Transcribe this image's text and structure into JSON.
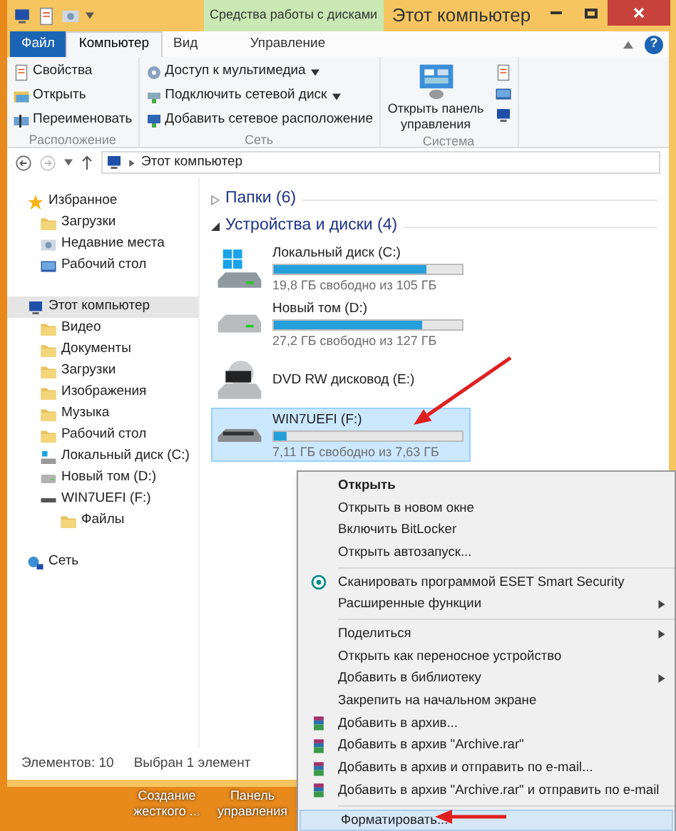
{
  "window": {
    "title": "Этот компьютер",
    "context_tab": "Средства работы с дисками"
  },
  "ribbon_tabs": [
    {
      "label": "Файл",
      "kind": "file",
      "selected": false
    },
    {
      "label": "Компьютер",
      "kind": "tab",
      "selected": true
    },
    {
      "label": "Вид",
      "kind": "tab",
      "selected": false
    },
    {
      "label": "Управление",
      "kind": "context",
      "selected": false
    }
  ],
  "help_button": "?",
  "ribbon_groups": [
    {
      "title": "Расположение",
      "kind": "list",
      "items": [
        {
          "label": "Свойства",
          "dropdown": false
        },
        {
          "label": "Открыть",
          "dropdown": false
        },
        {
          "label": "Переименовать",
          "dropdown": false
        }
      ]
    },
    {
      "title": "Сеть",
      "kind": "list",
      "items": [
        {
          "label": "Доступ к мультимедиа",
          "dropdown": true
        },
        {
          "label": "Подключить сетевой диск",
          "dropdown": true
        },
        {
          "label": "Добавить сетевое расположение",
          "dropdown": false
        }
      ]
    },
    {
      "title": "Система",
      "kind": "big",
      "items": [
        {
          "label": "Открыть панель управления"
        }
      ]
    }
  ],
  "address": {
    "path": "Этот компьютер"
  },
  "nav": [
    {
      "label": "Избранное",
      "selected": false,
      "children": [
        {
          "label": "Загрузки",
          "selected": false
        },
        {
          "label": "Недавние места",
          "selected": false
        },
        {
          "label": "Рабочий стол",
          "selected": false
        }
      ]
    },
    {
      "label": "Этот компьютер",
      "selected": true,
      "children": [
        {
          "label": "Видео",
          "selected": false
        },
        {
          "label": "Документы",
          "selected": false
        },
        {
          "label": "Загрузки",
          "selected": false
        },
        {
          "label": "Изображения",
          "selected": false
        },
        {
          "label": "Музыка",
          "selected": false
        },
        {
          "label": "Рабочий стол",
          "selected": false
        },
        {
          "label": "Локальный диск (C:)",
          "selected": false
        },
        {
          "label": "Новый том (D:)",
          "selected": false
        },
        {
          "label": "WIN7UEFI (F:)",
          "selected": false,
          "children": [
            {
              "label": "Файлы",
              "selected": false
            }
          ]
        }
      ]
    },
    {
      "label": "Сеть",
      "selected": false
    }
  ],
  "sections": [
    {
      "title": "Папки (6)",
      "expanded": false
    },
    {
      "title": "Устройства и диски (4)",
      "expanded": true
    }
  ],
  "drives": [
    {
      "name": "Локальный диск (C:)",
      "kind": "system",
      "level": 0.81,
      "free": "19,8 ГБ свободно из 105 ГБ",
      "selected": false
    },
    {
      "name": "Новый том (D:)",
      "kind": "disk",
      "level": 0.79,
      "free": "27,2 ГБ свободно из 127 ГБ",
      "selected": false
    },
    {
      "name": "DVD RW дисковод (E:)",
      "kind": "dvd",
      "selected": false
    },
    {
      "name": "WIN7UEFI (F:)",
      "kind": "usb",
      "level": 0.07,
      "free": "7,11 ГБ свободно из 7,63 ГБ",
      "selected": true
    }
  ],
  "status_bar": {
    "count": "Элементов: 10",
    "selection": "Выбран 1 элемент"
  },
  "desktop_icons": [
    {
      "label": "Создание жесткого ..."
    },
    {
      "label": "Панель управления"
    }
  ],
  "context_menu": [
    [
      {
        "label": "Открыть",
        "kind": "plain",
        "default": true,
        "submenu": false,
        "highlighted": false
      },
      {
        "label": "Открыть в новом окне",
        "kind": "plain",
        "default": false,
        "submenu": false,
        "highlighted": false
      },
      {
        "label": "Включить BitLocker",
        "kind": "plain",
        "default": false,
        "submenu": false,
        "highlighted": false
      },
      {
        "label": "Открыть автозапуск...",
        "kind": "plain",
        "default": false,
        "submenu": false,
        "highlighted": false
      }
    ],
    [
      {
        "label": "Сканировать программой ESET Smart Security",
        "kind": "eset",
        "default": false,
        "submenu": false,
        "highlighted": false
      },
      {
        "label": "Расширенные функции",
        "kind": "plain",
        "default": false,
        "submenu": true,
        "highlighted": false
      }
    ],
    [
      {
        "label": "Поделиться",
        "kind": "plain",
        "default": false,
        "submenu": true,
        "highlighted": false
      },
      {
        "label": "Открыть как переносное устройство",
        "kind": "plain",
        "default": false,
        "submenu": false,
        "highlighted": false
      },
      {
        "label": "Добавить в библиотеку",
        "kind": "plain",
        "default": false,
        "submenu": true,
        "highlighted": false
      },
      {
        "label": "Закрепить на начальном экране",
        "kind": "plain",
        "default": false,
        "submenu": false,
        "highlighted": false
      },
      {
        "label": "Добавить в архив...",
        "kind": "archive",
        "default": false,
        "submenu": false,
        "highlighted": false
      },
      {
        "label": "Добавить в архив \"Archive.rar\"",
        "kind": "archive",
        "default": false,
        "submenu": false,
        "highlighted": false
      },
      {
        "label": "Добавить в архив и отправить по e-mail...",
        "kind": "archive",
        "default": false,
        "submenu": false,
        "highlighted": false
      },
      {
        "label": "Добавить в архив \"Archive.rar\" и отправить по e-mail",
        "kind": "archive",
        "default": false,
        "submenu": false,
        "highlighted": false
      }
    ],
    [
      {
        "label": "Форматировать...",
        "kind": "plain",
        "default": false,
        "submenu": false,
        "highlighted": true
      }
    ]
  ],
  "annotations": [
    {
      "kind": "arrow"
    },
    {
      "kind": "arrow"
    }
  ]
}
